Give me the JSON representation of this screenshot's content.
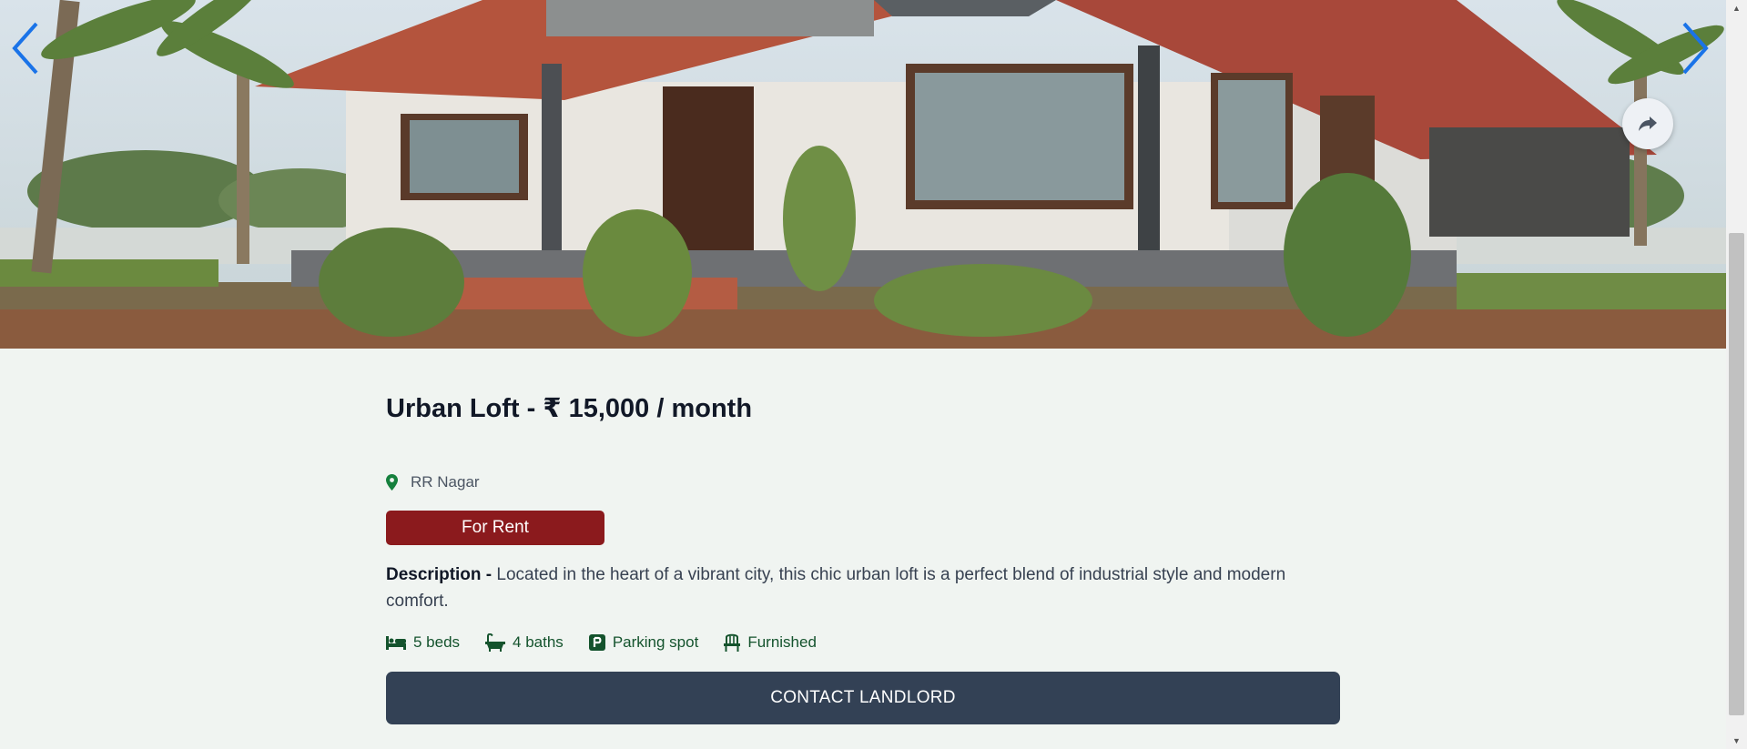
{
  "listing": {
    "title": "Urban Loft - ₹ 15,000 / month",
    "location": "RR Nagar",
    "badge": "For Rent",
    "description_label": "Description -",
    "description": " Located in the heart of a vibrant city, this chic urban loft is a perfect blend of industrial style and modern comfort.",
    "amenities": {
      "beds": "5 beds",
      "baths": "4 baths",
      "parking": "Parking spot",
      "furnished": "Furnished"
    },
    "contact_label": "CONTACT LANDLORD"
  },
  "carousel": {
    "prev_icon": "chevron-left-icon",
    "next_icon": "chevron-right-icon",
    "share_icon": "share-icon"
  },
  "colors": {
    "badge": "#8b1a1d",
    "contact_button": "#334155",
    "amenity_text": "#14532d",
    "location_pin": "#15803d",
    "page_background": "#f0f4f1",
    "carousel_arrow": "#1a73e8"
  }
}
